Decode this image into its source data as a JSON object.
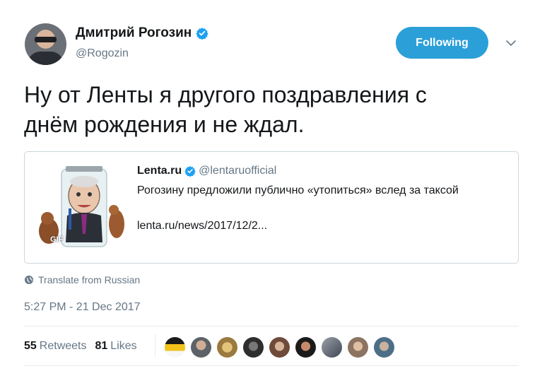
{
  "author": {
    "name": "Дмитрий Рогозин",
    "handle": "@Rogozin",
    "verified": true
  },
  "follow_button": {
    "label": "Following",
    "color": "#2b9fd8"
  },
  "tweet": {
    "line1": "Ну от Ленты я другого поздравления с",
    "line2": "днём рождения и не ждал."
  },
  "quoted": {
    "name": "Lenta.ru",
    "handle": "@lentaruofficial",
    "verified": true,
    "text": "Рогозину предложили публично «утопиться» вслед за таксой",
    "link": "lenta.ru/news/2017/12/2...",
    "media_badge": "GIF"
  },
  "translate": {
    "label": "Translate from Russian"
  },
  "timestamp": "5:27 PM - 21 Dec 2017",
  "stats": {
    "retweets_count": "55",
    "retweets_label": "Retweets",
    "likes_count": "81",
    "likes_label": "Likes"
  },
  "likers_count_shown": 9,
  "colors": {
    "accent": "#1da1f2",
    "text": "#14171a",
    "secondary": "#657786"
  }
}
